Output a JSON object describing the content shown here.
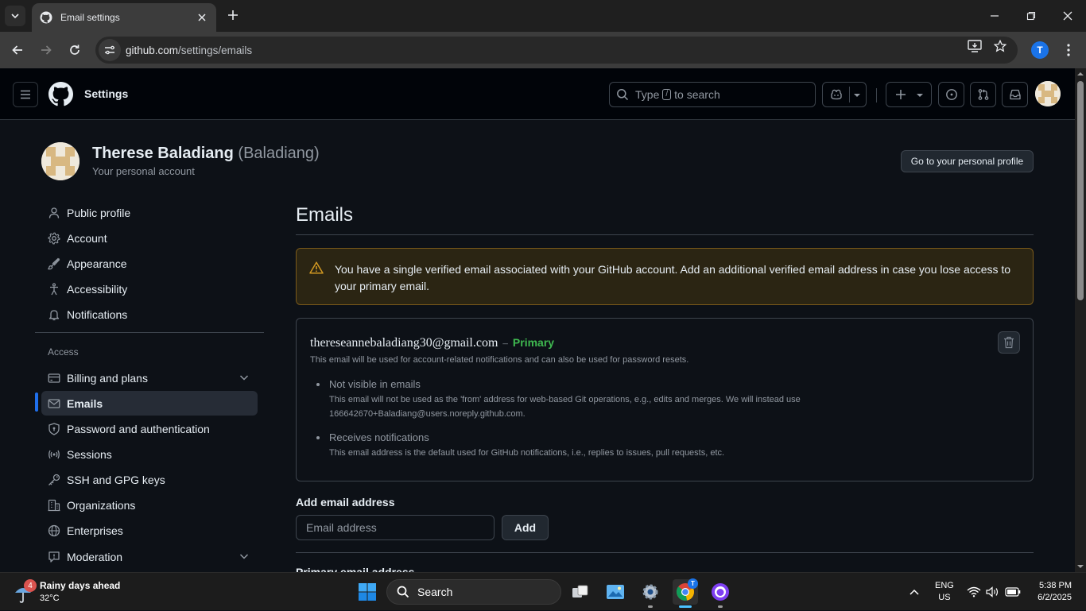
{
  "browser": {
    "tab_title": "Email settings",
    "url_host": "github.com",
    "url_path": "/settings/emails"
  },
  "header": {
    "context": "Settings",
    "search_prefix": "Type",
    "search_key": "/",
    "search_suffix": "to search"
  },
  "profile": {
    "name": "Therese Baladiang",
    "login": "(Baladiang)",
    "subtitle": "Your personal account",
    "goto_button": "Go to your personal profile"
  },
  "sidebar": {
    "items": [
      {
        "label": "Public profile",
        "icon": "person-icon"
      },
      {
        "label": "Account",
        "icon": "gear-icon"
      },
      {
        "label": "Appearance",
        "icon": "paintbrush-icon"
      },
      {
        "label": "Accessibility",
        "icon": "accessibility-icon"
      },
      {
        "label": "Notifications",
        "icon": "bell-icon"
      }
    ],
    "access_heading": "Access",
    "access_items": [
      {
        "label": "Billing and plans",
        "icon": "credit-card-icon"
      },
      {
        "label": "Emails",
        "icon": "mail-icon"
      },
      {
        "label": "Password and authentication",
        "icon": "shield-lock-icon"
      },
      {
        "label": "Sessions",
        "icon": "broadcast-icon"
      },
      {
        "label": "SSH and GPG keys",
        "icon": "key-icon"
      },
      {
        "label": "Organizations",
        "icon": "organization-icon"
      },
      {
        "label": "Enterprises",
        "icon": "globe-icon"
      },
      {
        "label": "Moderation",
        "icon": "report-icon"
      }
    ]
  },
  "main": {
    "title": "Emails",
    "flash": "You have a single verified email associated with your GitHub account. Add an additional verified email address in case you lose access to your primary email.",
    "email": {
      "address": "thereseannebaladiang30@gmail.com",
      "dash": "–",
      "badge": "Primary",
      "note": "This email will be used for account-related notifications and can also be used for password resets.",
      "bullets": [
        {
          "title": "Not visible in emails",
          "desc": "This email will not be used as the 'from' address for web-based Git operations, e.g., edits and merges. We will instead use 166642670+Baladiang@users.noreply.github.com."
        },
        {
          "title": "Receives notifications",
          "desc": "This email address is the default used for GitHub notifications, i.e., replies to issues, pull requests, etc."
        }
      ]
    },
    "add_label": "Add email address",
    "add_placeholder": "Email address",
    "add_button": "Add",
    "next_heading": "Primary email address"
  },
  "taskbar": {
    "weather_badge": "4",
    "weather_title": "Rainy days ahead",
    "weather_temp": "32°C",
    "search_label": "Search",
    "lang_1": "ENG",
    "lang_2": "US",
    "time": "5:38 PM",
    "date": "6/2/2025",
    "chrome_badge": "T"
  },
  "colors": {
    "accent": "#1f6feb",
    "primary_badge": "#3fb950",
    "flash_bg": "#2b2513",
    "flash_border": "#7b5a1a"
  }
}
